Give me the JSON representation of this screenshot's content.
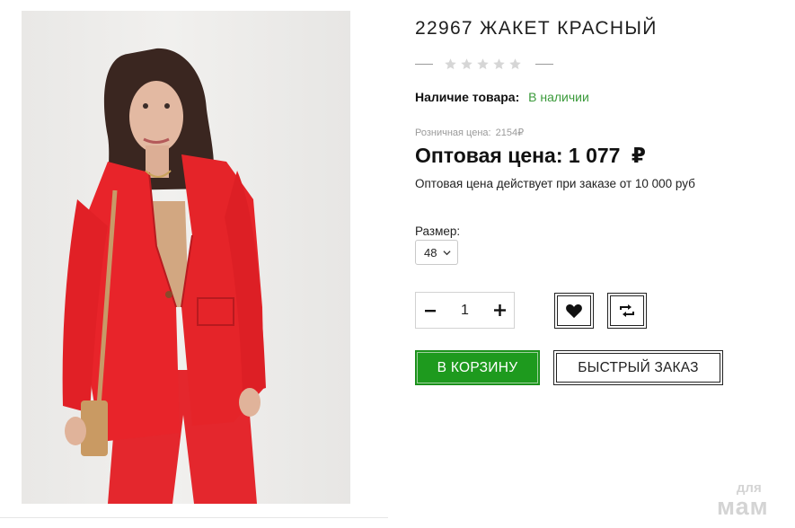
{
  "product": {
    "title": "22967 ЖАКЕТ КРАСНЫЙ",
    "rating_stars": 5,
    "rating_filled": 0,
    "availability_label": "Наличие товара:",
    "availability_value": "В наличии",
    "retail_label": "Розничная цена:",
    "retail_price": "2154₽",
    "wholesale_label": "Оптовая цена:",
    "wholesale_price": "1 077",
    "currency": "₽",
    "wholesale_note": "Оптовая цена действует при заказе от 10 000 руб",
    "image_alt": "model wearing red jacket and red trousers"
  },
  "size": {
    "label": "Размер:",
    "selected": "48"
  },
  "quantity": {
    "value": "1",
    "minus_icon": "minus-icon",
    "plus_icon": "plus-icon"
  },
  "actions": {
    "wishlist_icon": "heart-icon",
    "compare_icon": "compare-icon",
    "cart_label": "В КОРЗИНУ",
    "quick_order_label": "БЫСТРЫЙ ЗАКАЗ"
  },
  "watermark": {
    "line1": "для",
    "line2": "мам"
  },
  "colors": {
    "accent_green": "#1e9a1e",
    "availability_green": "#3a9a3a",
    "jacket_red": "#e8242a",
    "star_empty": "#d6d6d6"
  }
}
